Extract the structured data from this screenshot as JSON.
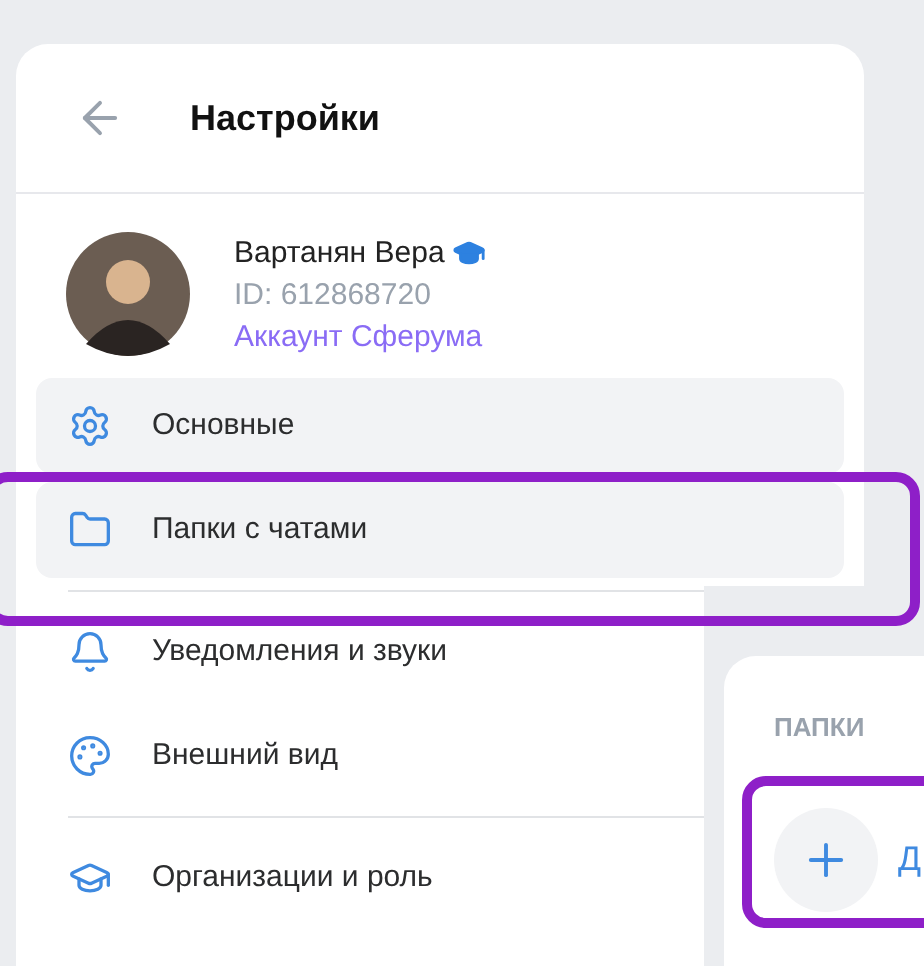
{
  "header": {
    "title": "Настройки"
  },
  "profile": {
    "name": "Вартанян Вера",
    "id": "ID: 612868720",
    "account_link": "Аккаунт Сферума"
  },
  "menu_groups": [
    [
      {
        "label": "Основные",
        "highlighted": true
      },
      {
        "label": "Папки с чатами",
        "highlighted": true
      }
    ],
    [
      {
        "label": "Уведомления и звуки",
        "highlighted": false
      },
      {
        "label": "Внешний вид",
        "highlighted": false
      }
    ],
    [
      {
        "label": "Организации и роль",
        "highlighted": false
      }
    ]
  ],
  "folders_panel": {
    "section_title": "ПАПКИ",
    "add_label": "Д"
  }
}
